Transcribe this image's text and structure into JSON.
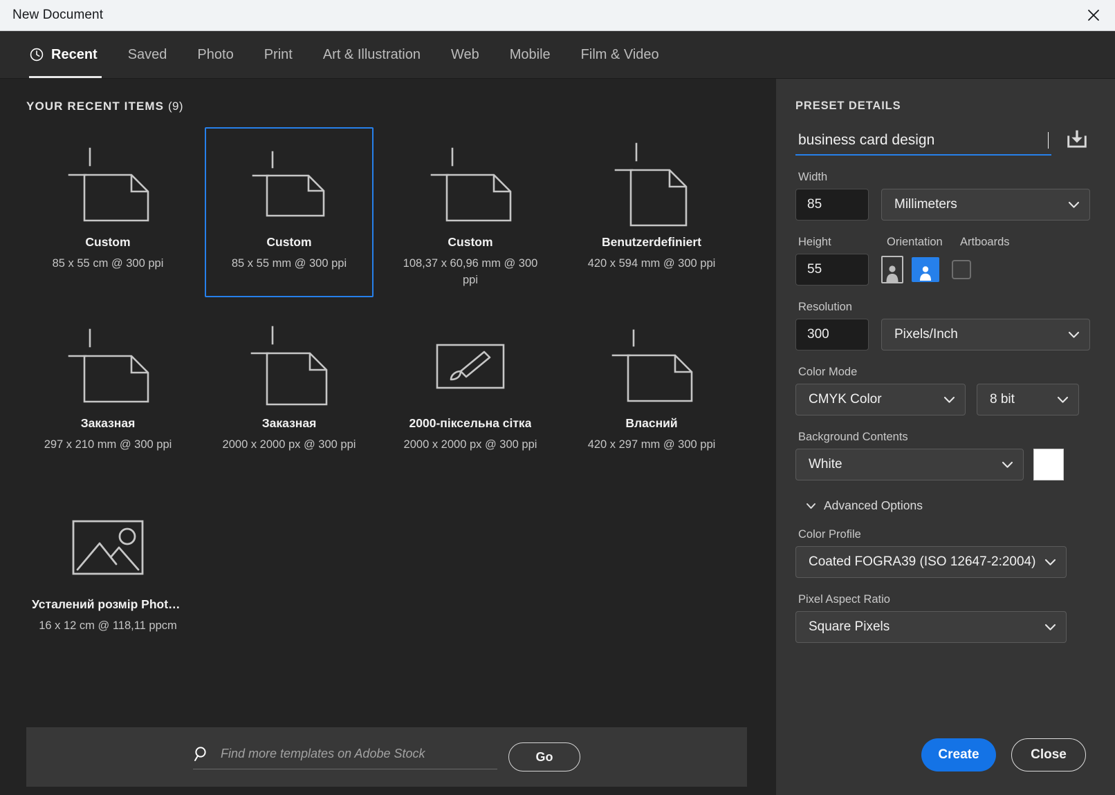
{
  "window": {
    "title": "New Document",
    "close_icon": "close-x-icon"
  },
  "tabs": [
    {
      "label": "Recent",
      "icon": "clock-icon",
      "active": true
    },
    {
      "label": "Saved",
      "active": false
    },
    {
      "label": "Photo",
      "active": false
    },
    {
      "label": "Print",
      "active": false
    },
    {
      "label": "Art & Illustration",
      "active": false
    },
    {
      "label": "Web",
      "active": false
    },
    {
      "label": "Mobile",
      "active": false
    },
    {
      "label": "Film & Video",
      "active": false
    }
  ],
  "recent": {
    "heading": "YOUR RECENT ITEMS",
    "count": "(9)",
    "items": [
      {
        "name": "Custom",
        "dimensions": "85 x 55 cm @ 300 ppi",
        "icon": "document-landscape-icon",
        "selected": false
      },
      {
        "name": "Custom",
        "dimensions": "85 x 55 mm @ 300 ppi",
        "icon": "document-landscape-icon",
        "selected": true
      },
      {
        "name": "Custom",
        "dimensions": "108,37 x 60,96 mm @ 300 ppi",
        "icon": "document-landscape-icon",
        "selected": false
      },
      {
        "name": "Benutzerdefiniert",
        "dimensions": "420 x 594 mm @ 300 ppi",
        "icon": "document-portrait-icon",
        "selected": false
      },
      {
        "name": "Заказная",
        "dimensions": "297 x 210 mm @ 300 ppi",
        "icon": "document-landscape-icon",
        "selected": false
      },
      {
        "name": "Заказная",
        "dimensions": "2000 x 2000 px @ 300 ppi",
        "icon": "document-square-icon",
        "selected": false
      },
      {
        "name": "2000-піксельна сітка",
        "dimensions": "2000 x 2000 px @ 300 ppi",
        "icon": "paintbrush-icon",
        "selected": false
      },
      {
        "name": "Власний",
        "dimensions": "420 x 297 mm @ 300 ppi",
        "icon": "document-landscape-icon",
        "selected": false
      },
      {
        "name": "Усталений розмір Photos...",
        "dimensions": "16 x 12 cm @ 118,11 ppcm",
        "icon": "photo-image-icon",
        "selected": false
      }
    ]
  },
  "stock": {
    "search_value": "",
    "placeholder": "Find more templates on Adobe Stock",
    "search_icon": "search-icon",
    "go_label": "Go"
  },
  "preset": {
    "section_title": "PRESET DETAILS",
    "name_value": "business card design",
    "save_preset_icon": "save-preset-download-icon",
    "width_label": "Width",
    "width_value": "85",
    "width_unit": "Millimeters",
    "height_label": "Height",
    "height_value": "55",
    "orientation_label": "Orientation",
    "orientation_portrait_icon": "orientation-portrait-icon",
    "orientation_landscape_icon": "orientation-landscape-icon",
    "orientation_selected": "landscape",
    "artboards_label": "Artboards",
    "artboards_checked": false,
    "resolution_label": "Resolution",
    "resolution_value": "300",
    "resolution_unit": "Pixels/Inch",
    "color_mode_label": "Color Mode",
    "color_mode_value": "CMYK Color",
    "bit_depth_value": "8 bit",
    "background_label": "Background Contents",
    "background_value": "White",
    "background_swatch_color": "#ffffff",
    "advanced_label": "Advanced Options",
    "color_profile_label": "Color Profile",
    "color_profile_value": "Coated FOGRA39 (ISO 12647-2:2004)",
    "pixel_aspect_label": "Pixel Aspect Ratio",
    "pixel_aspect_value": "Square Pixels"
  },
  "footer": {
    "create_label": "Create",
    "close_label": "Close"
  },
  "colors": {
    "accent_blue": "#2680eb",
    "primary_button": "#1473e6",
    "left_panel_bg": "#232323",
    "right_panel_bg": "#353535",
    "titlebar_bg": "#f1f3f5"
  }
}
